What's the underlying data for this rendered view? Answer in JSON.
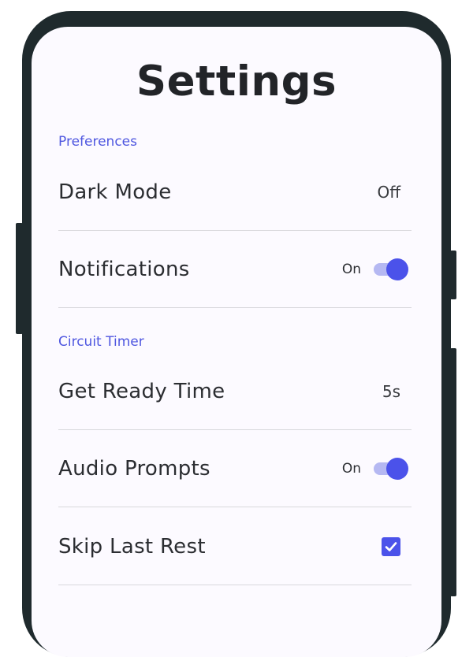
{
  "page": {
    "title": "Settings"
  },
  "sections": [
    {
      "header": "Preferences",
      "rows": [
        {
          "label": "Dark Mode",
          "value": "Off",
          "control": "value"
        },
        {
          "label": "Notifications",
          "value": "On",
          "control": "toggle",
          "toggle_on": true
        }
      ]
    },
    {
      "header": "Circuit Timer",
      "rows": [
        {
          "label": "Get Ready Time",
          "value": "5s",
          "control": "value"
        },
        {
          "label": "Audio Prompts",
          "value": "On",
          "control": "toggle",
          "toggle_on": true
        },
        {
          "label": "Skip Last Rest",
          "control": "checkbox",
          "checked": true
        }
      ]
    }
  ],
  "colors": {
    "accent": "#4b52ea",
    "accent_light": "#b5b8f2",
    "section_header": "#4f57e0",
    "frame": "#1f2a2d",
    "screen_bg": "#fcfaff"
  },
  "icons": {
    "checkbox_checked": "check-icon"
  }
}
